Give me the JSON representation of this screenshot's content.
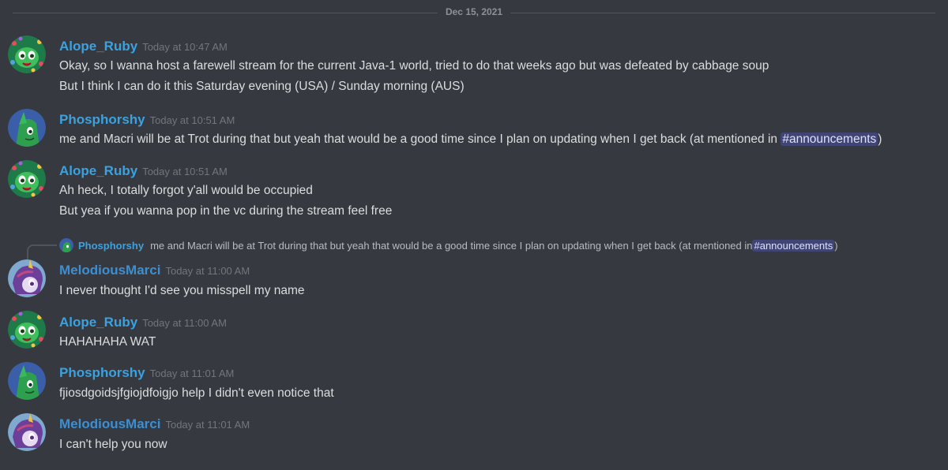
{
  "divider": {
    "date": "Dec 15, 2021"
  },
  "messages": [
    {
      "username": "Alope_Ruby",
      "timestamp": "Today at 10:47 AM",
      "avatar": "green-pony-avatar",
      "lines": [
        "Okay, so I wanna host a farewell stream for the current Java-1 world, tried to do that weeks ago but was defeated by cabbage soup",
        "But I think I can do it this Saturday evening (USA) / Sunday morning (AUS)"
      ]
    },
    {
      "username": "Phosphorshy",
      "timestamp": "Today at 10:51 AM",
      "avatar": "green-pony-blue-bg-avatar",
      "text_before": "me and Macri will be at Trot during that but yeah that would be a good time since I plan on updating when I get back (at mentioned in ",
      "mention": "#announcements",
      "text_after": ")"
    },
    {
      "username": "Alope_Ruby",
      "timestamp": "Today at 10:51 AM",
      "avatar": "green-pony-avatar",
      "lines": [
        "Ah heck, I totally forgot y'all would be occupied",
        "But yea if you wanna pop in the vc during the stream feel free"
      ]
    },
    {
      "reply": {
        "username": "Phosphorshy",
        "text_before": "me and Macri will be at Trot during that but yeah that would be a good time since I plan on updating when I get back (at mentioned in ",
        "mention": "#announcements",
        "text_after": ")"
      },
      "username": "MelodiousMarci",
      "timestamp": "Today at 11:00 AM",
      "avatar": "purple-pony-avatar",
      "lines": [
        "I never thought I'd see you misspell my name"
      ]
    },
    {
      "username": "Alope_Ruby",
      "timestamp": "Today at 11:00 AM",
      "avatar": "green-pony-avatar",
      "lines": [
        "HAHAHAHA WAT"
      ]
    },
    {
      "username": "Phosphorshy",
      "timestamp": "Today at 11:01 AM",
      "avatar": "green-pony-blue-bg-avatar",
      "lines": [
        "fjiosdgoidsjfgiojdfoigjo help I didn't even notice that"
      ]
    },
    {
      "username": "MelodiousMarci",
      "timestamp": "Today at 11:01 AM",
      "avatar": "purple-pony-avatar",
      "lines": [
        "I can't help you now"
      ]
    }
  ],
  "colors": {
    "background": "#36393f",
    "username_blue": "#3ba2e0",
    "timestamp": "#72767d",
    "mention_bg": "#5865f2"
  }
}
